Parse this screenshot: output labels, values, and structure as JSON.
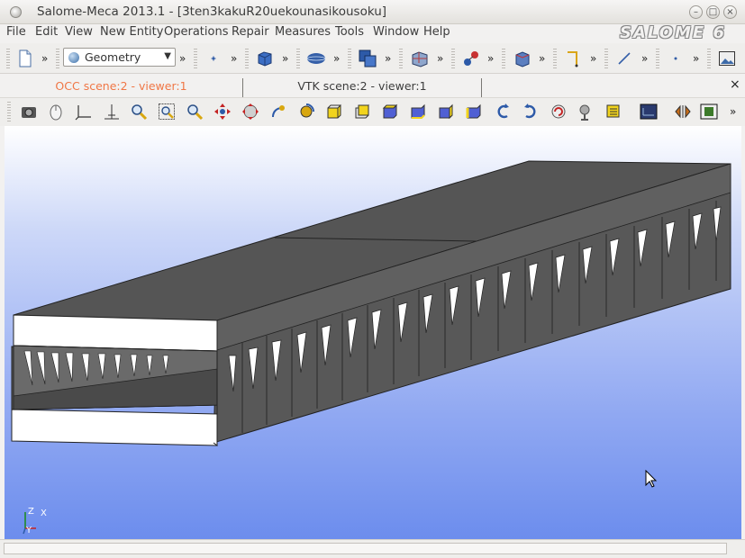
{
  "window": {
    "title": "Salome-Meca 2013.1 - [3ten3kakuR20uekounasikousoku]",
    "controls": {
      "minimize": "–",
      "maximize": "□",
      "close": "×"
    }
  },
  "menubar": {
    "items": [
      {
        "label": "File"
      },
      {
        "label": "Edit"
      },
      {
        "label": "View"
      },
      {
        "label": "New Entity"
      },
      {
        "label": "Operations"
      },
      {
        "label": "Repair"
      },
      {
        "label": "Measures"
      },
      {
        "label": "Tools"
      },
      {
        "label": "Window"
      },
      {
        "label": "Help"
      }
    ]
  },
  "logo": {
    "text": "SALOME 6"
  },
  "toolbar": {
    "module_select": {
      "value": "Geometry",
      "icon": "geometry-icon"
    },
    "more_label": "»",
    "icons": [
      "new-document-icon",
      "point-icon",
      "box-icon",
      "ellipsoid-icon",
      "boolean-union-icon",
      "partition-icon",
      "transform-icon",
      "explode-icon",
      "measure-icon",
      "line-icon",
      "vertex-icon",
      "screenshot-icon"
    ]
  },
  "viewer_tabs": [
    {
      "label": "OCC scene:2 - viewer:1",
      "active": true
    },
    {
      "label": "VTK scene:2 - viewer:1",
      "active": false
    }
  ],
  "tab_close": "×",
  "axes": {
    "z": "Z",
    "x": "X",
    "y": "Y"
  },
  "colors": {
    "accent_tab": "#f07746",
    "model_face": "#555555",
    "viewport_top": "#ffffff",
    "viewport_bottom": "#6c8ded"
  }
}
